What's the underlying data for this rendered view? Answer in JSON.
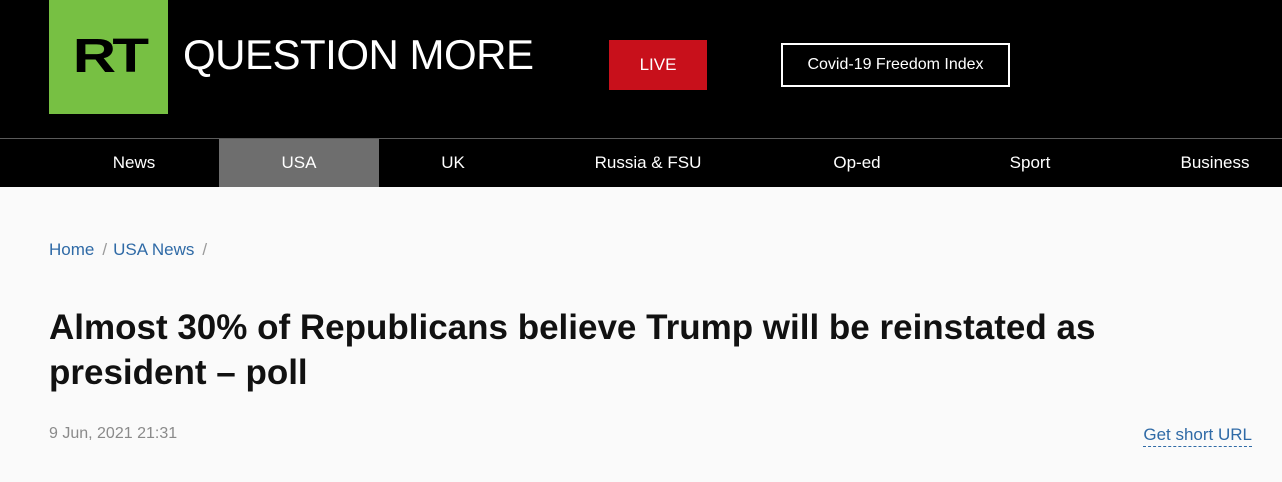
{
  "header": {
    "logo_text": "RT",
    "tagline": "QUESTION MORE",
    "live_label": "LIVE",
    "covid_label": "Covid-19 Freedom Index"
  },
  "nav": {
    "items": [
      {
        "label": "News"
      },
      {
        "label": "USA",
        "active": true
      },
      {
        "label": "UK"
      },
      {
        "label": "Russia & FSU"
      },
      {
        "label": "Op-ed"
      },
      {
        "label": "Sport"
      },
      {
        "label": "Business"
      }
    ]
  },
  "breadcrumb": {
    "home": "Home",
    "section": "USA News",
    "separator": "/"
  },
  "article": {
    "headline": "Almost 30% of Republicans believe Trump will be reinstated as president – poll",
    "date": "9 Jun, 2021 21:31",
    "short_url_label": "Get short URL"
  },
  "colors": {
    "brand_green": "#77c043",
    "live_red": "#c8101b",
    "link_blue": "#2f6aa6",
    "nav_active_gray": "#6e6e6e"
  }
}
